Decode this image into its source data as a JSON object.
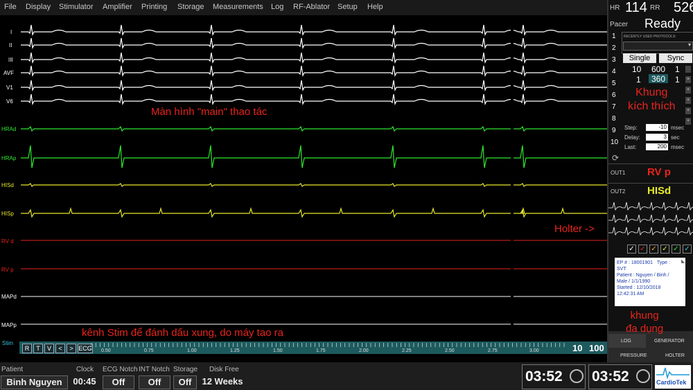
{
  "menu": [
    "File",
    "Display",
    "Stimulator",
    "Amplifier",
    "Printing",
    "Storage",
    "Measurements",
    "Log",
    "RF-Ablator",
    "Setup",
    "Help"
  ],
  "channels": [
    {
      "label": "I",
      "color": "#ffffff"
    },
    {
      "label": "II",
      "color": "#ffffff"
    },
    {
      "label": "III",
      "color": "#ffffff"
    },
    {
      "label": "AVF",
      "color": "#ffffff"
    },
    {
      "label": "V1",
      "color": "#ffffff"
    },
    {
      "label": "V6",
      "color": "#ffffff"
    },
    {
      "label": "HRAd",
      "color": "#2ee82e"
    },
    {
      "label": "HRAp",
      "color": "#2ee82e"
    },
    {
      "label": "HISd",
      "color": "#e8e82e"
    },
    {
      "label": "HISp",
      "color": "#e8e82e"
    },
    {
      "label": "RV d",
      "color": "#e8241c"
    },
    {
      "label": "RV p",
      "color": "#e8241c"
    },
    {
      "label": "MAPd",
      "color": "#ffffff"
    },
    {
      "label": "MAPp",
      "color": "#ffffff"
    },
    {
      "label": "Stim",
      "color": "#35c7e0"
    }
  ],
  "annotations": {
    "main": "Màn hình \"main\" thao tác",
    "holter": "Holter ->",
    "stim": "kênh Stim để đánh dấu xung, do máy tao ra"
  },
  "timebar": {
    "buttons": [
      "R",
      "T",
      "V",
      "<",
      ">",
      "ECG"
    ],
    "ticks": [
      "0.50",
      "0.75",
      "1.00",
      "1.25",
      "1.50",
      "1.75",
      "2.00",
      "2.25",
      "2.50",
      "2.75",
      "3.00"
    ],
    "speed_a": "10",
    "speed_b": "100"
  },
  "vitals": {
    "hr_label": "HR",
    "hr": "114",
    "rr_label": "RR",
    "rr": "526",
    "pacer_label": "Pacer",
    "pacer_status": "Ready"
  },
  "stimulator": {
    "recent_label": "RECENTLY USED PROTOCOLS:",
    "row_numbers": [
      "1",
      "2",
      "3",
      "4",
      "5",
      "6",
      "7",
      "8",
      "9",
      "10"
    ],
    "single_label": "Single",
    "sync_label": "Sync",
    "row4": [
      "10",
      "600",
      "1"
    ],
    "row5": [
      "1",
      "360",
      "1"
    ],
    "annot": "Khung\nkích thích",
    "step_label": "Step:",
    "step_value": "-10",
    "step_unit": "msec",
    "delay_label": "Delay:",
    "delay_value": "3",
    "delay_unit": "sec",
    "last_label": "Last:",
    "last_value": "200",
    "last_unit": "msec"
  },
  "outputs": {
    "out1_label": "OUT1",
    "out1_value": "RV p",
    "out2_label": "OUT2",
    "out2_value": "HISd"
  },
  "checks": [
    "#ffffff",
    "#e8241c",
    "#f5a623",
    "#e8e82e",
    "#2ee82e",
    "#35c7e0"
  ],
  "info": {
    "ep": "EP # : 18001901",
    "type": "Type :",
    "type_value": "SVT",
    "patient": "Patient : Nguyen / Binh /",
    "patient2": "Male / 1/1/1990",
    "started": "Started : 12/10/2018",
    "time": "12:42:31 AM"
  },
  "multi_annot": "khung\nđa dụng",
  "tabs": [
    "LOG",
    "GENERATOR",
    "PRESSURE",
    "HOLTER"
  ],
  "status": {
    "patient_label": "Patient",
    "patient": "Binh Nguyen",
    "clock_label": "Clock",
    "clock": "00:45",
    "ecg_label": "ECG Notch",
    "ecg": "Off",
    "int_label": "INT Notch",
    "int": "Off",
    "storage_label": "Storage",
    "storage": "Off",
    "disk_label": "Disk Free",
    "disk": "12 Weeks",
    "timer1": "03:52",
    "timer2": "03:52",
    "logo": "CardioTek"
  }
}
